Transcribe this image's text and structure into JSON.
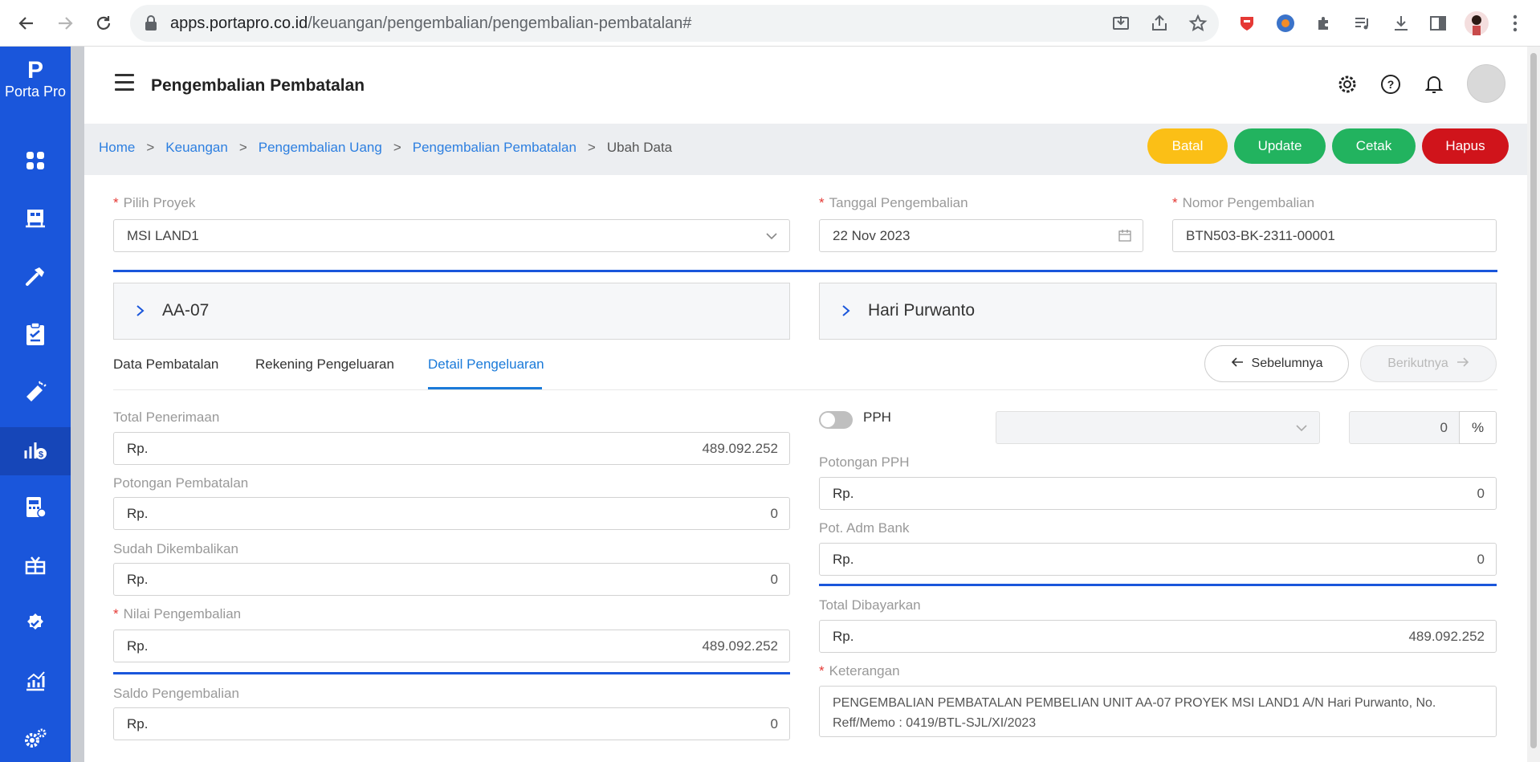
{
  "browser": {
    "url_domain": "apps.portapro.co.id",
    "url_path": "/keuangan/pengembalian/pengembalian-pembatalan#"
  },
  "sidebar": {
    "logo_mark": "P",
    "logo_text": "Porta Pro",
    "items": [
      {
        "icon": "dashboard-icon"
      },
      {
        "icon": "property-icon"
      },
      {
        "icon": "hammer-icon"
      },
      {
        "icon": "clipboard-icon"
      },
      {
        "icon": "marketing-icon"
      },
      {
        "icon": "finance-icon"
      },
      {
        "icon": "billing-icon"
      },
      {
        "icon": "handover-icon"
      },
      {
        "icon": "approval-icon"
      },
      {
        "icon": "report-icon"
      },
      {
        "icon": "settings-icon"
      }
    ],
    "active_index": 5
  },
  "header": {
    "title": "Pengembalian Pembatalan"
  },
  "breadcrumb": {
    "home": "Home",
    "keuangan": "Keuangan",
    "pengembalian_uang": "Pengembalian Uang",
    "pengembalian_pembatalan": "Pengembalian Pembatalan",
    "current": "Ubah Data",
    "sep": ">"
  },
  "actions": {
    "batal": "Batal",
    "update": "Update",
    "cetak": "Cetak",
    "hapus": "Hapus",
    "colors": {
      "batal": "#fbbf16",
      "update": "#22b35f",
      "cetak": "#22b35f",
      "hapus": "#d0141b"
    }
  },
  "form": {
    "required_mark": "*",
    "proyek_label": "Pilih Proyek",
    "proyek_value": "MSI LAND1",
    "tanggal_label": "Tanggal Pengembalian",
    "tanggal_value": "22 Nov 2023",
    "nomor_label": "Nomor Pengembalian",
    "nomor_value": "BTN503-BK-2311-00001"
  },
  "cards": {
    "unit": "AA-07",
    "customer": "Hari Purwanto"
  },
  "tabs": {
    "data_pembatalan": "Data Pembatalan",
    "rekening_pengeluaran": "Rekening Pengeluaran",
    "detail_pengeluaran": "Detail Pengeluaran"
  },
  "pager": {
    "prev": "Sebelumnya",
    "next": "Berikutnya"
  },
  "currency": "Rp.",
  "left": {
    "total_penerimaan_label": "Total Penerimaan",
    "total_penerimaan": "489.092.252",
    "potongan_pembatalan_label": "Potongan Pembatalan",
    "potongan_pembatalan": "0",
    "sudah_dikembalikan_label": "Sudah Dikembalikan",
    "sudah_dikembalikan": "0",
    "nilai_pengembalian_label": "Nilai Pengembalian",
    "nilai_pengembalian": "489.092.252",
    "saldo_pengembalian_label": "Saldo Pengembalian",
    "saldo_pengembalian": "0"
  },
  "right": {
    "pph_label": "PPH",
    "pph_enabled": false,
    "pph_percent": "0",
    "percent_sign": "%",
    "potongan_pph_label": "Potongan PPH",
    "potongan_pph": "0",
    "pot_adm_bank_label": "Pot. Adm Bank",
    "pot_adm_bank": "0",
    "total_dibayarkan_label": "Total Dibayarkan",
    "total_dibayarkan": "489.092.252",
    "keterangan_label": "Keterangan",
    "keterangan": "PENGEMBALIAN PEMBATALAN PEMBELIAN UNIT AA-07 PROYEK MSI LAND1 A/N Hari Purwanto, No. Reff/Memo : 0419/BTL-SJL/XI/2023"
  }
}
